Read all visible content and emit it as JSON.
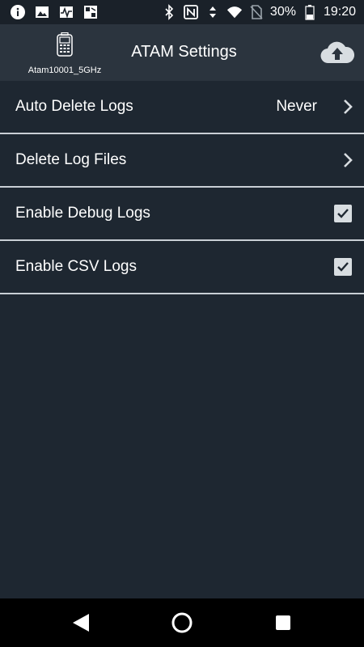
{
  "status_bar": {
    "battery_percent": "30%",
    "time": "19:20",
    "left_icons": [
      "info-icon",
      "image-icon",
      "activity-icon",
      "app-icon"
    ],
    "right_icons": [
      "bluetooth-icon",
      "nfc-icon",
      "data-arrows-icon",
      "wifi-icon",
      "no-sim-icon",
      "battery-icon"
    ]
  },
  "header": {
    "device_name": "Atam10001_5GHz",
    "title": "ATAM Settings",
    "upload_icon": "cloud-upload-icon"
  },
  "settings": {
    "auto_delete": {
      "label": "Auto Delete Logs",
      "value": "Never"
    },
    "delete_files": {
      "label": "Delete Log Files"
    },
    "debug_logs": {
      "label": "Enable Debug Logs",
      "checked": true
    },
    "csv_logs": {
      "label": "Enable CSV Logs",
      "checked": true
    }
  },
  "nav": {
    "buttons": [
      "back-icon",
      "home-icon",
      "recents-icon"
    ]
  },
  "colors": {
    "background": "#1e2731",
    "header": "#2b343e",
    "divider": "#c9cfd5",
    "checkbox": "#d8dde1"
  }
}
